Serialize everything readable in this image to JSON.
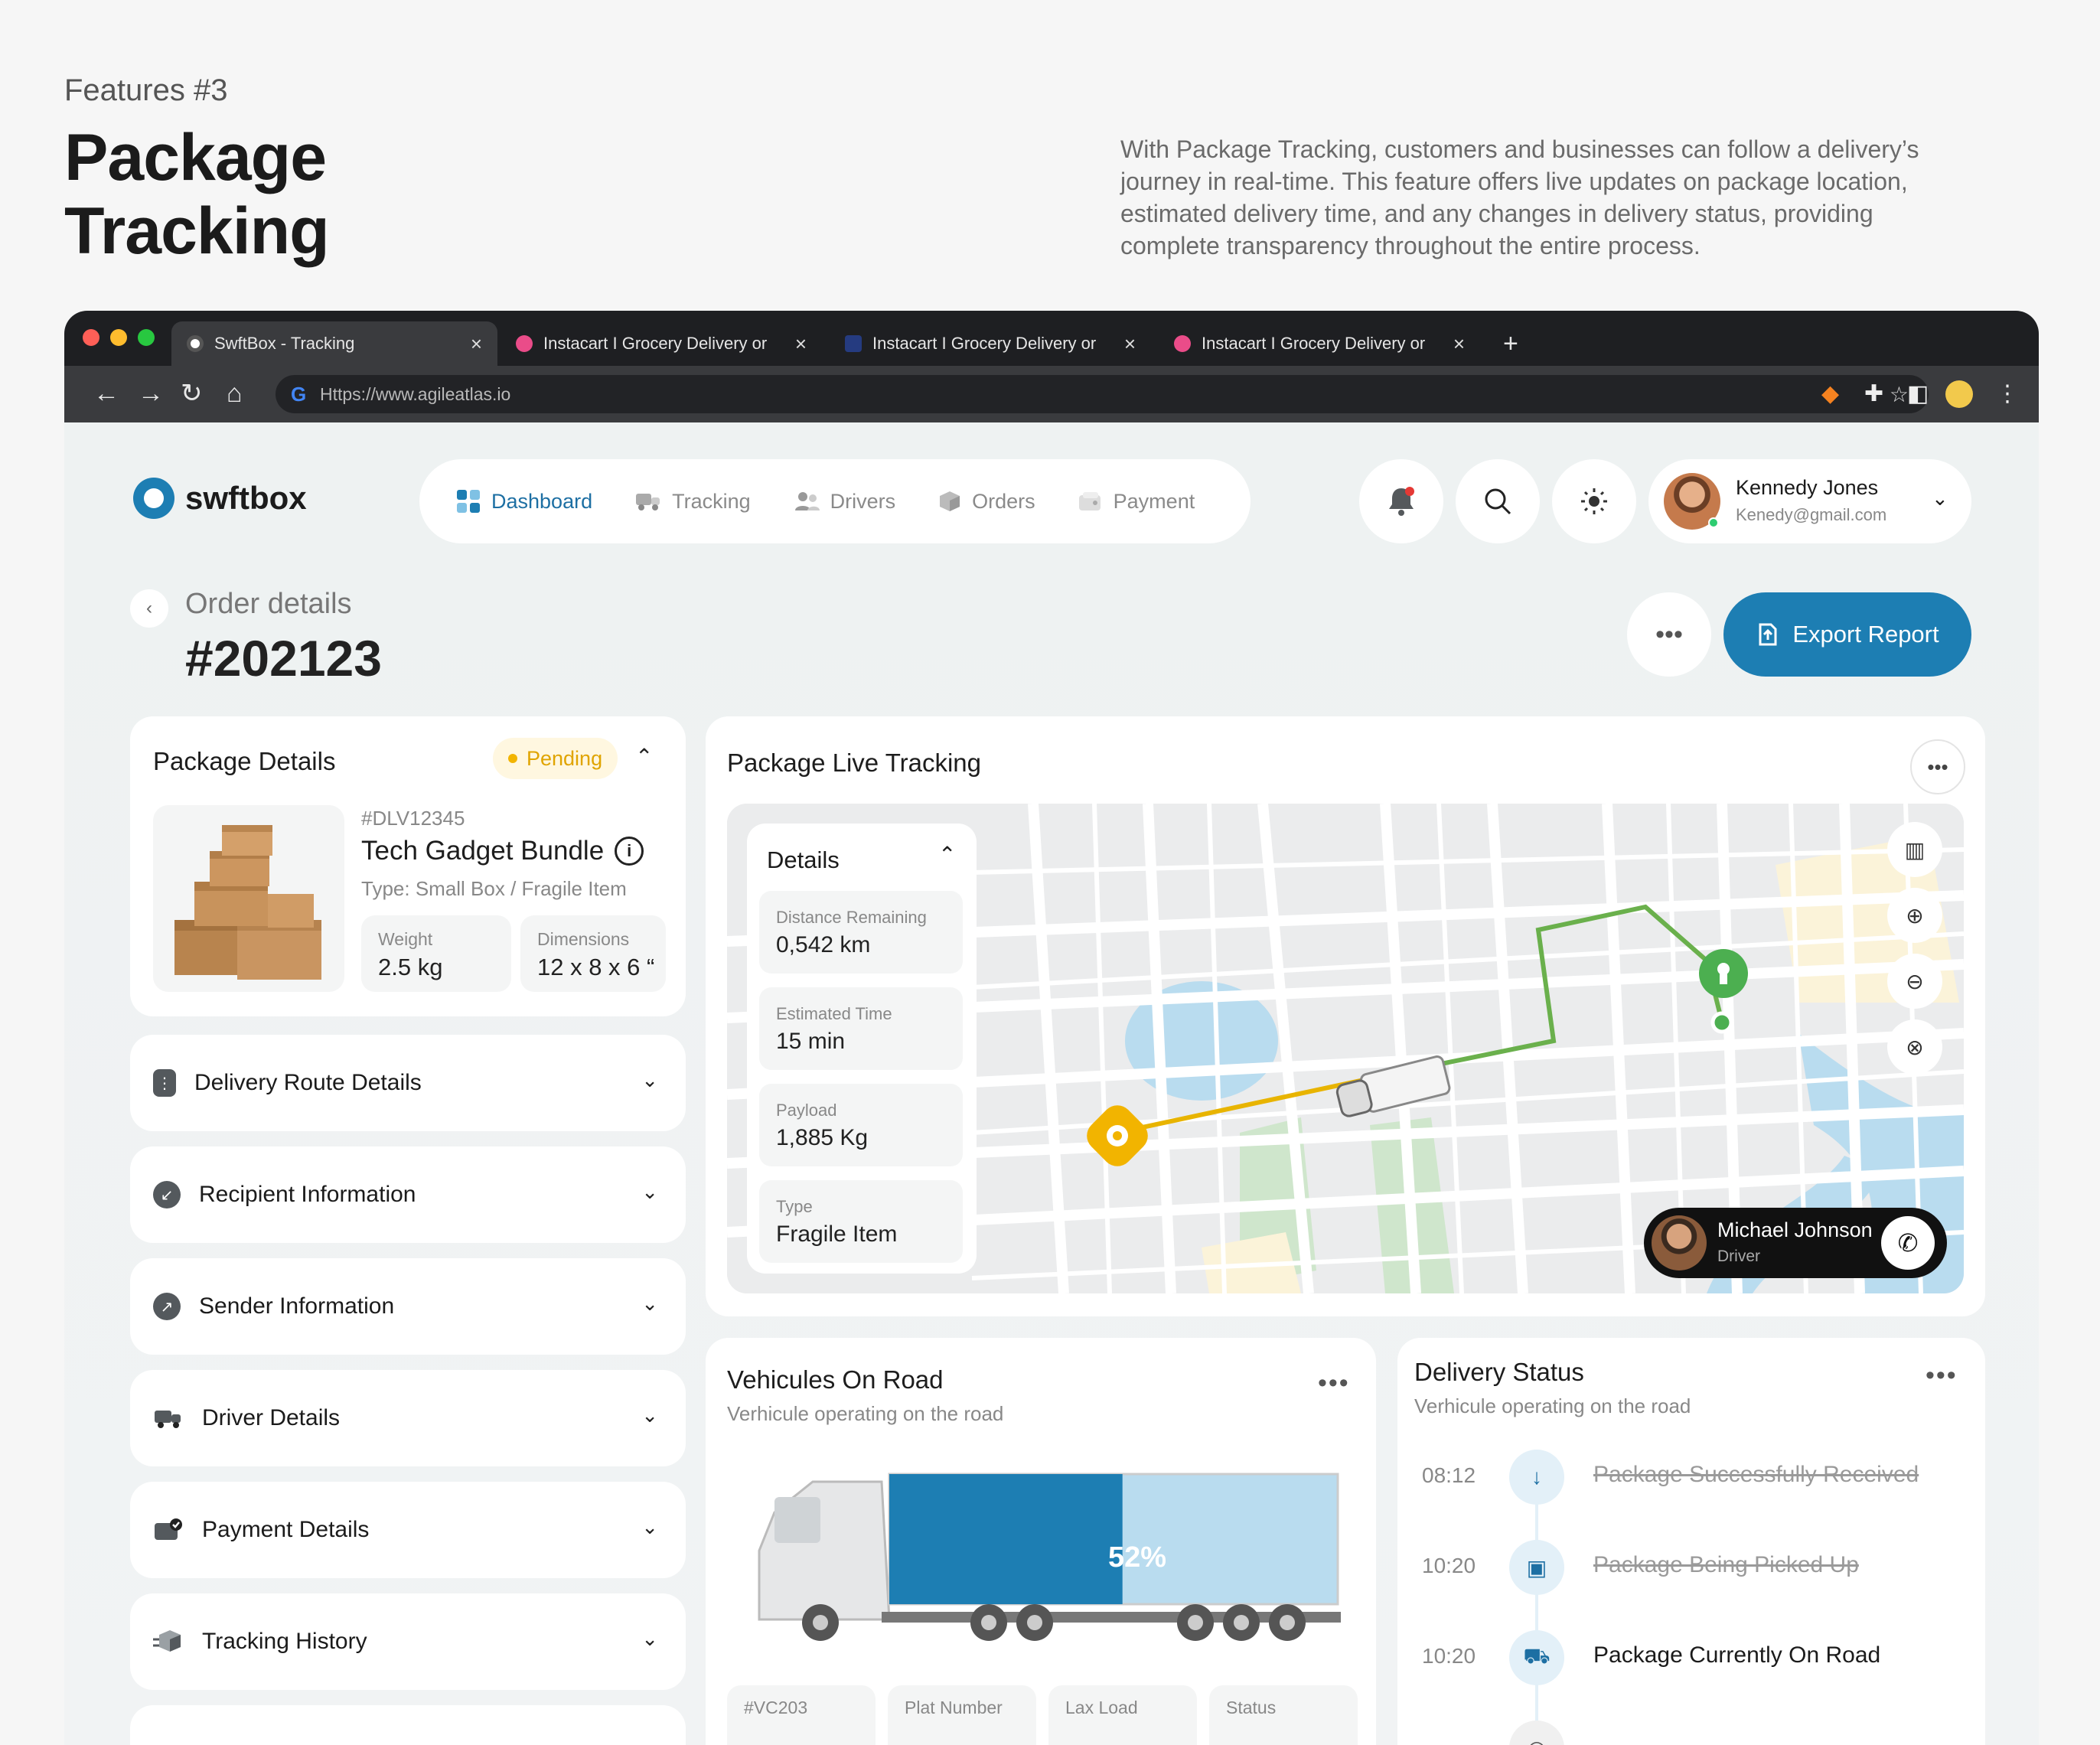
{
  "page": {
    "kicker": "Features #3",
    "title": "Package Tracking",
    "description": "With Package Tracking, customers and businesses can follow a delivery’s journey in real-time. This feature offers live updates on package location, estimated delivery time, and any changes in delivery status, providing complete transparency throughout the entire process."
  },
  "browser": {
    "tabs": [
      {
        "label": "SwftBox - Tracking",
        "active": true
      },
      {
        "label": "Instacart I Grocery Delivery or",
        "active": false
      },
      {
        "label": "Instacart I Grocery Delivery or",
        "active": false
      },
      {
        "label": "Instacart I Grocery Delivery or",
        "active": false
      }
    ],
    "new_tab": "+",
    "close": "×",
    "url": "Https://www.agileatlas.io"
  },
  "app": {
    "brand": "swftbox",
    "nav": [
      "Dashboard",
      "Tracking",
      "Drivers",
      "Orders",
      "Payment"
    ],
    "user": {
      "name": "Kennedy Jones",
      "email": "Kenedy@gmail.com"
    },
    "order": {
      "label": "Order details",
      "number": "#202123"
    },
    "export_label": "Export Report",
    "more": "•••"
  },
  "package": {
    "title": "Package Details",
    "status": "Pending",
    "id": "#DLV12345",
    "name": "Tech Gadget Bundle",
    "type": "Type: Small Box / Fragile Item",
    "weight_label": "Weight",
    "weight": "2.5 kg",
    "dimensions_label": "Dimensions",
    "dimensions": "12 x 8 x 6 “"
  },
  "accordion": [
    "Delivery Route Details",
    "Recipient Information",
    "Sender Information",
    "Driver Details",
    "Payment Details",
    "Tracking History"
  ],
  "tracking": {
    "title": "Package Live Tracking",
    "details_title": "Details",
    "details": [
      {
        "label": "Distance Remaining",
        "value": "0,542 km"
      },
      {
        "label": "Estimated Time",
        "value": "15 min"
      },
      {
        "label": "Payload",
        "value": "1,885 Kg"
      },
      {
        "label": "Type",
        "value": "Fragile Item"
      }
    ],
    "driver": {
      "name": "Michael Johnson",
      "role": "Driver"
    }
  },
  "vehicles": {
    "title": "Vehicules On Road",
    "subtitle": "Verhicule operating on the road",
    "load_percent": 52,
    "load_label": "52%",
    "stats": [
      {
        "label": "#VC203"
      },
      {
        "label": "Plat Number"
      },
      {
        "label": "Lax Load"
      },
      {
        "label": "Status"
      }
    ]
  },
  "delivery_status": {
    "title": "Delivery Status",
    "subtitle": "Verhicule operating on the road",
    "items": [
      {
        "time": "08:12",
        "text": "Package Successfully Received",
        "done": true
      },
      {
        "time": "10:20",
        "text": "Package Being Picked Up",
        "done": true
      },
      {
        "time": "10:20",
        "text": "Package Currently On Road",
        "done": false
      }
    ]
  },
  "colors": {
    "accent": "#1d7eb3",
    "pending": "#f2b400",
    "route_green": "#6ab04c",
    "route_yellow": "#e8b400",
    "water": "#b9dcef"
  }
}
